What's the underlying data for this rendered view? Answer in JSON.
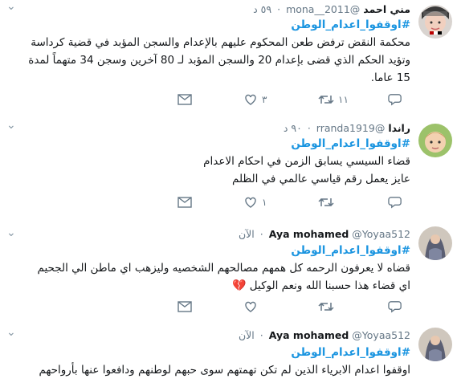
{
  "tweets": [
    {
      "name": "مني احمد",
      "handle": "@mona__2011",
      "time": "٥٩ د",
      "hashtag": "#اوقفوا_اعدام_الوطن",
      "lines": [
        "محكمة النقض ترفض طعن المحكوم عليهم بالإعدام والسجن المؤبد في قضية كرداسة",
        "وتؤيد الحكم الذي قضى بإعدام 20 والسجن المؤبد لـ 80 آخرين وسجن 34 متهماً لمدة",
        "15 عاما."
      ],
      "replies": "",
      "retweets": "١١",
      "likes": "٣"
    },
    {
      "name": "راندا",
      "handle": "@rranda1919",
      "time": "٩٠ د",
      "hashtag": "#اوقفوا_اعدام_الوطن",
      "lines": [
        "قضاء السيسي يسابق الزمن في احكام الاعدام",
        "عايز يعمل رقم قياسي عالمي في الظلم"
      ],
      "replies": "",
      "retweets": "",
      "likes": "١"
    },
    {
      "name": "Aya mohamed",
      "handle": "@Yoyaa512",
      "time": "الآن",
      "hashtag": "#اوقفوا_اعدام_الوطن",
      "lines": [
        "قضاه لا يعرفون الرحمه كل همهم مصالحهم الشخصيه وليزهب اي ماطن الي الجحيم",
        "اي قضاء هذا حسبنا الله ونعم الوكيل"
      ],
      "heart": "💔",
      "replies": "",
      "retweets": "",
      "likes": ""
    },
    {
      "name": "Aya mohamed",
      "handle": "@Yoyaa512",
      "time": "الآن",
      "hashtag": "#اوقفوا_اعدام_الوطن",
      "lines": [
        "اوقفوا اعدام الابرياء الذين لم تكن تهمتهم سوى حبهم لوطنهم ودافعوا عنها بأرواحهم"
      ]
    }
  ],
  "colors": {
    "link": "#1b95e0",
    "muted": "#657786",
    "border": "#e1e8ed"
  }
}
